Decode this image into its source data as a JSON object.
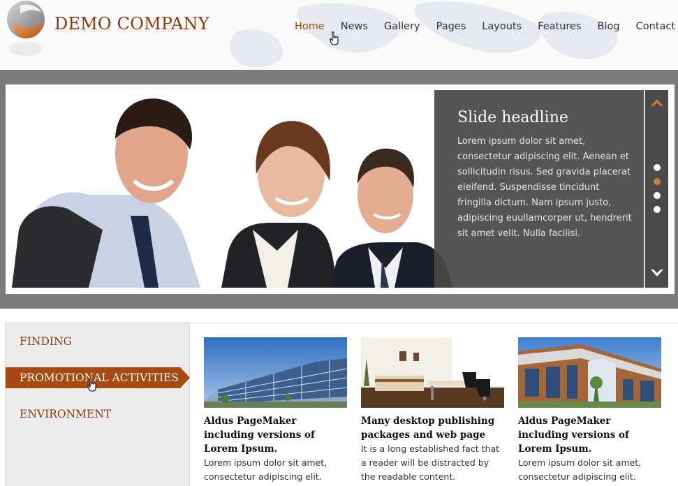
{
  "header": {
    "company_name": "DEMO COMPANY",
    "nav": [
      "Home",
      "News",
      "Gallery",
      "Pages",
      "Layouts",
      "Features",
      "Blog",
      "Contact"
    ],
    "active_nav": "Home",
    "accent_color": "#a8490f"
  },
  "slider": {
    "headline": "Slide headline",
    "text": "Lorem ipsum dolor sit amet, consectetur adipiscing elit. Aenean et sollicitudin risus. Sed gravida placerat eleifend. Suspendisse tincidunt fringilla dictum. Nam ipsum justo, adipiscing euullamcorper ut, hendrerit sit amet velit. Nulla facilisi.",
    "dot_count": 4,
    "active_dot": 2
  },
  "sidebar": {
    "items": [
      "FINDING",
      "PROMOTIONAL ACTIVITIES",
      "ENVIRONMENT"
    ],
    "active": "PROMOTIONAL ACTIVITIES"
  },
  "cards": [
    {
      "title": "Aldus PageMaker including versions of Lorem Ipsum.",
      "text": "Lorem ipsum dolor sit amet, consectetur adipiscing elit. Aenean et sollicitudin risus."
    },
    {
      "title": "Many desktop publishing packages and web page",
      "text": "It is a long established fact that a reader will be distracted by the readable content."
    },
    {
      "title": "Aldus PageMaker including versions of Lorem Ipsum.",
      "text": "Lorem ipsum dolor sit amet, consectetur adipiscing elit. Aenean et sollicitudin risus."
    }
  ]
}
